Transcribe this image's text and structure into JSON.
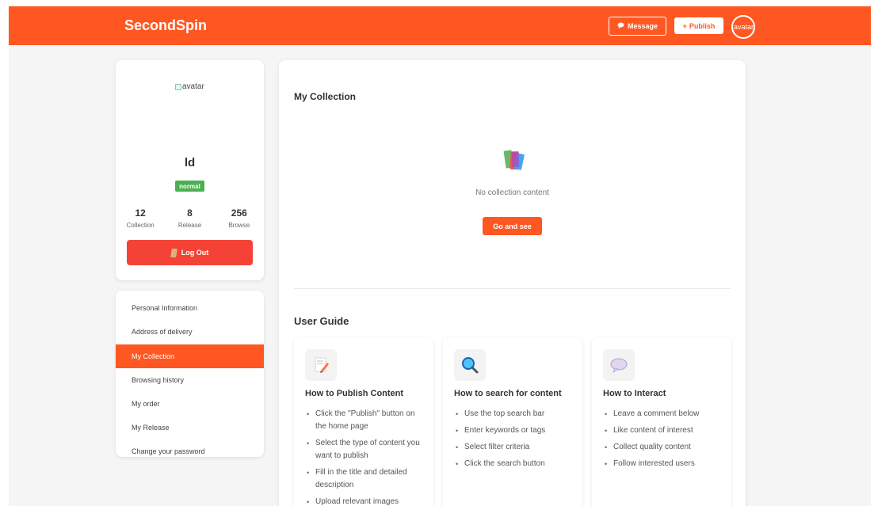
{
  "header": {
    "logo": "SecondSpin",
    "message_label": "Message",
    "publish_label": "Publish",
    "avatar_alt": "avatar"
  },
  "profile": {
    "avatar_alt": "avatar",
    "username": "ld",
    "level": "normal",
    "stats": [
      {
        "value": "12",
        "label": "Collection"
      },
      {
        "value": "8",
        "label": "Release"
      },
      {
        "value": "256",
        "label": "Browse"
      }
    ],
    "logout_label": "Log Out"
  },
  "menu": {
    "items": [
      {
        "label": "Personal Information"
      },
      {
        "label": "Address of delivery"
      },
      {
        "label": "My Collection"
      },
      {
        "label": "Browsing history"
      },
      {
        "label": "My order"
      },
      {
        "label": "My Release"
      },
      {
        "label": "Change your password"
      }
    ],
    "active_index": 2
  },
  "main": {
    "section_title": "My Collection",
    "empty_text": "No collection content",
    "go_label": "Go and see",
    "guide_title": "User Guide",
    "guides": [
      {
        "icon": "pencil-paper-icon",
        "heading": "How to Publish Content",
        "items": [
          "Click the \"Publish\" button on the home page",
          "Select the type of content you want to publish",
          "Fill in the title and detailed description",
          "Upload relevant images"
        ]
      },
      {
        "icon": "magnifier-icon",
        "heading": "How to search for content",
        "items": [
          "Use the top search bar",
          "Enter keywords or tags",
          "Select filter criteria",
          "Click the search button"
        ]
      },
      {
        "icon": "speech-bubble-icon",
        "heading": "How to Interact",
        "items": [
          "Leave a comment below",
          "Like content of interest",
          "Collect quality content",
          "Follow interested users"
        ]
      }
    ]
  },
  "colors": {
    "brand": "#ff5722",
    "logout": "#f44336",
    "badge": "#4caf50"
  }
}
